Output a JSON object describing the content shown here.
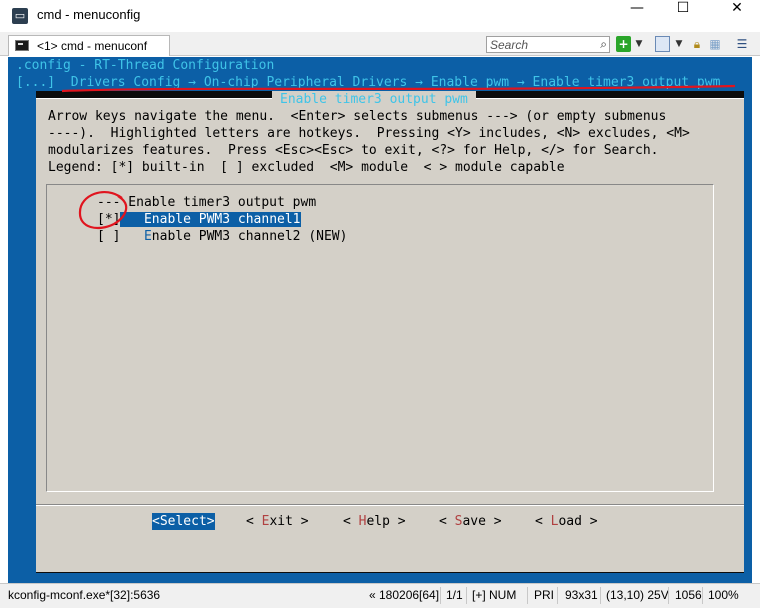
{
  "window": {
    "title": "cmd - menuconfig",
    "app_icon": "console-app-icon",
    "controls": {
      "minimize": "—",
      "maximize": "☐",
      "close": "✕"
    }
  },
  "toolbar": {
    "tab_label": "<1> cmd - menuconf",
    "search_placeholder": "Search",
    "icons": [
      "console-icon",
      "search-icon",
      "new-console-plus-icon",
      "dropdown-icon",
      "panel-layout-icon",
      "lock-icon",
      "grid-icon",
      "hamburger-menu-icon"
    ]
  },
  "terminal": {
    "config_line": ".config - RT-Thread Configuration",
    "breadcrumb_line": "[...]  Drivers Config → On-chip Peripheral Drivers → Enable pwm → Enable timer3 output pwm",
    "dialog_title": "Enable timer3 output pwm",
    "help_lines": [
      "Arrow keys navigate the menu.  <Enter> selects submenus ---> (or empty submenus",
      "----).  Highlighted letters are hotkeys.  Pressing <Y> includes, <N> excludes, <M>",
      "modularizes features.  Press <Esc><Esc> to exit, <?> for Help, </> for Search.",
      "Legend: [*] built-in  [ ] excluded  <M> module  < > module capable"
    ],
    "menu": {
      "header": "--- Enable timer3 output pwm",
      "items": [
        {
          "checkbox": "[*]",
          "hotkey": "E",
          "rest": "nable PWM3 channel1",
          "selected": true
        },
        {
          "checkbox": "[ ]",
          "hotkey": "E",
          "rest": "nable PWM3 channel2 (NEW)",
          "selected": false
        }
      ]
    },
    "buttons": [
      {
        "pre": "<",
        "label": "Select",
        "post": ">",
        "hotkey_index": -1,
        "active": true
      },
      {
        "pre": "< ",
        "hk": "E",
        "rest": "xit",
        "post": " >",
        "active": false
      },
      {
        "pre": "< ",
        "hk": "H",
        "rest": "elp",
        "post": " >",
        "active": false
      },
      {
        "pre": "< ",
        "hk": "S",
        "rest": "ave",
        "post": " >",
        "active": false
      },
      {
        "pre": "< ",
        "hk": "L",
        "rest": "oad",
        "post": " >",
        "active": false
      }
    ]
  },
  "statusbar": {
    "process": "kconfig-mconf.exe*[32]:5636",
    "info": "« 180206[64]",
    "position": "1/1",
    "mode": "[+] NUM",
    "pri": "PRI",
    "size": "93x31",
    "cursor": "(13,10) 25V",
    "pid": "1056",
    "zoom": "100%"
  },
  "colors": {
    "terminal_blue": "#0c5fa6",
    "dialog_gray": "#d4d0c8",
    "breadcrumb_cyan": "#3fc4e8",
    "annotation_red": "#e0141e"
  }
}
